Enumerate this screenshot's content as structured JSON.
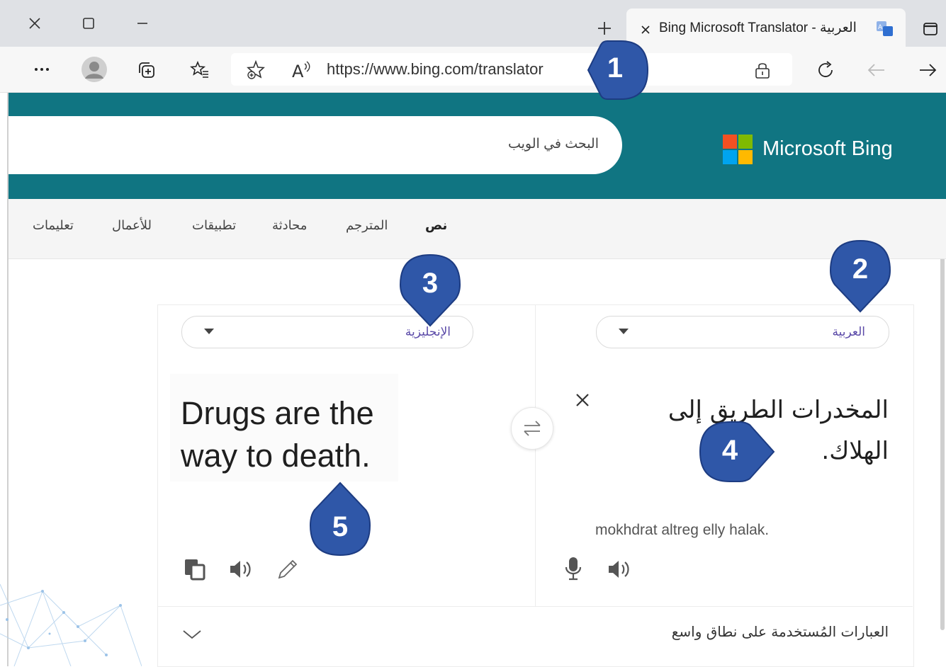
{
  "browser": {
    "tab_title": "Bing Microsoft Translator - العربية",
    "url": "https://www.bing.com/translator",
    "icons": [
      "close-icon",
      "maximize-icon",
      "minimize-icon",
      "new-tab-icon",
      "tab-close-icon",
      "translate-favicon",
      "window-icon",
      "more-icon",
      "profile-icon",
      "collections-icon",
      "favorites-icon",
      "add-favorite-icon",
      "read-aloud-icon",
      "lock-icon",
      "refresh-icon",
      "back-icon",
      "forward-icon"
    ]
  },
  "bing": {
    "logo_text": "Microsoft Bing",
    "search_placeholder": "البحث في الويب",
    "nav": [
      "نص",
      "المترجم",
      "محادثة",
      "تطبيقات",
      "للأعمال",
      "تعليمات"
    ],
    "brand_color": "#107582"
  },
  "translator": {
    "source_lang": "العربية",
    "target_lang": "الإنجليزية",
    "source_text": "المخدرات الطريق إلى الهلاك.",
    "transliteration": "mokhdrat altreg elly halak.",
    "target_text": "Drugs are the way to death.",
    "phrases_label": "العبارات المُستخدمة على نطاق واسع"
  },
  "callouts": [
    "1",
    "2",
    "3",
    "4",
    "5"
  ],
  "callout_color": "#2f57a8"
}
